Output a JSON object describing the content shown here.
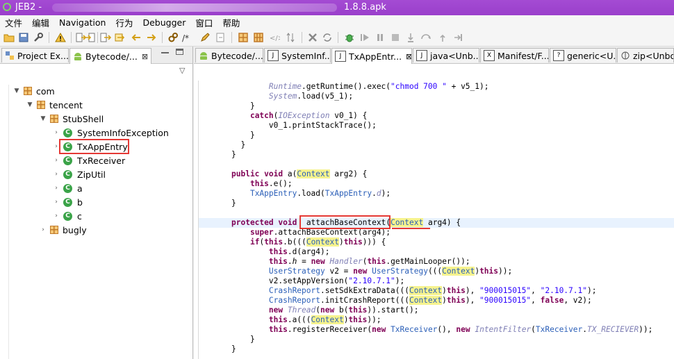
{
  "window": {
    "title_prefix": "JEB2 -",
    "title_suffix": "1.8.8.apk"
  },
  "menu": [
    {
      "label": "文件"
    },
    {
      "label": "编辑"
    },
    {
      "label": "Navigation"
    },
    {
      "label": "行为"
    },
    {
      "label": "Debugger"
    },
    {
      "label": "窗口"
    },
    {
      "label": "帮助"
    }
  ],
  "left_tabs": [
    {
      "label": "Project Ex..."
    },
    {
      "label": "Bytecode/..."
    }
  ],
  "left_tab_close": "⊠",
  "view_menu_glyph": "▽",
  "tree": [
    {
      "label": "com"
    },
    {
      "label": "tencent"
    },
    {
      "label": "StubShell"
    },
    {
      "label": "SystemInfoException"
    },
    {
      "label": "TxAppEntry"
    },
    {
      "label": "TxReceiver"
    },
    {
      "label": "ZipUtil"
    },
    {
      "label": "a"
    },
    {
      "label": "b"
    },
    {
      "label": "c"
    },
    {
      "label": "bugly"
    }
  ],
  "editor_tabs": [
    {
      "label": "Bytecode/..."
    },
    {
      "label": "SystemInf..."
    },
    {
      "label": "TxAppEntr..."
    },
    {
      "label": "java<Unb..."
    },
    {
      "label": "Manifest/F..."
    },
    {
      "label": "generic<U..."
    },
    {
      "label": "zip<Unbo"
    }
  ],
  "editor_tab_close": "⊠",
  "code": {
    "l0": [
      "Runtime",
      ".getRuntime().exec(",
      "\"chmod 700 \"",
      " + v5_1);"
    ],
    "l1": [
      "System",
      ".load(v5_1);"
    ],
    "l2": "}",
    "l3": [
      "catch",
      "(",
      "IOException",
      " v0_1) {"
    ],
    "l4": "v0_1.printStackTrace();",
    "l5": "}",
    "l6": "}",
    "l7": "}",
    "l8": [
      "public",
      "void",
      "a(",
      "Context",
      " arg2) {"
    ],
    "l9": [
      "this",
      ".e();"
    ],
    "l10": [
      "TxAppEntry",
      ".load(",
      "TxAppEntry",
      ".",
      "d",
      ");"
    ],
    "l11": "}",
    "l12": [
      "protected",
      "void",
      "attachBaseContext",
      "(",
      "Context",
      " arg4) {"
    ],
    "l13": [
      "super",
      ".attachBaseContext(arg4);"
    ],
    "l14": [
      "if",
      "(",
      "this",
      ".b(((",
      "Context",
      ")",
      "this",
      "))) {"
    ],
    "l15": [
      "this",
      ".d(arg4);"
    ],
    "l16": [
      "this",
      ".",
      "h",
      " = ",
      "new",
      "Handler",
      "(",
      "this",
      ".getMainLooper());"
    ],
    "l17": [
      "UserStrategy",
      " v2 = ",
      "new",
      "UserStrategy",
      "(((",
      "Context",
      ")",
      "this",
      "));"
    ],
    "l18": [
      "v2.setAppVersion(",
      "\"2.10.7.1\"",
      ");"
    ],
    "l19": [
      "CrashReport",
      ".setSdkExtraData(((",
      "Context",
      ")",
      "this",
      "), ",
      "\"900015015\"",
      ", ",
      "\"2.10.7.1\"",
      ");"
    ],
    "l20": [
      "CrashReport",
      ".initCrashReport(((",
      "Context",
      ")",
      "this",
      "), ",
      "\"900015015\"",
      ", ",
      "false",
      ", v2);"
    ],
    "l21": [
      "new",
      "Thread",
      "(",
      "new",
      " b(",
      "this",
      ")).start();"
    ],
    "l22": [
      "this",
      ".a(((",
      "Context",
      ")",
      "this",
      "));"
    ],
    "l23": [
      "this",
      ".registerReceiver(",
      "new",
      "TxReceiver",
      "(), ",
      "new",
      "IntentFilter",
      "(",
      "TxReceiver",
      ".",
      "TX_RECIEVER",
      "));"
    ],
    "l24": "}",
    "l25": "}"
  }
}
